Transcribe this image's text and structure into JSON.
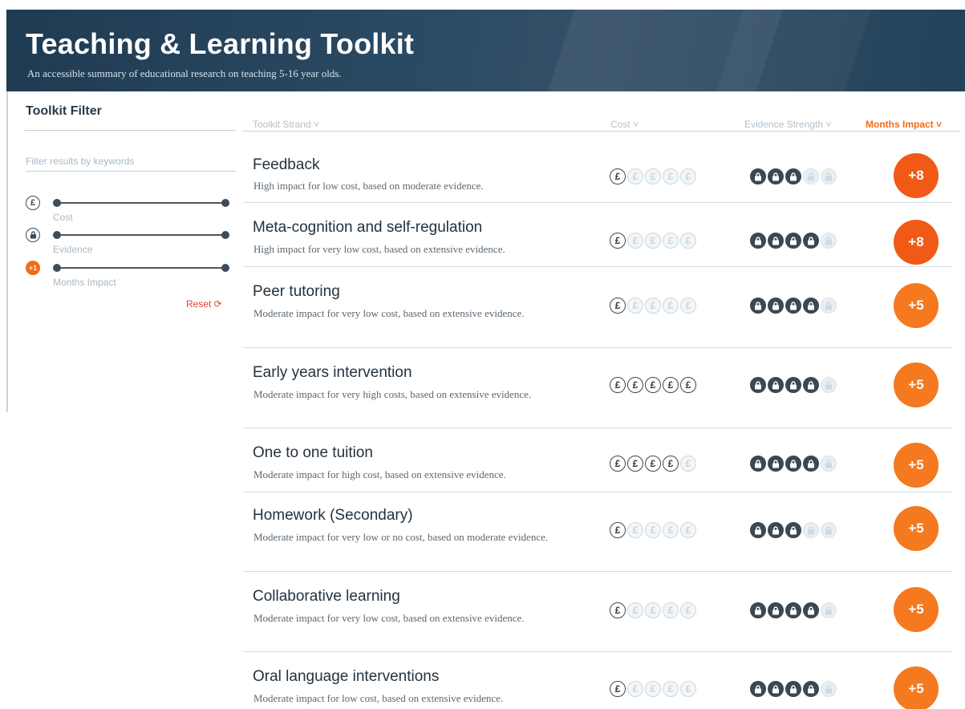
{
  "header": {
    "title": "Teaching & Learning Toolkit",
    "subtitle": "An accessible summary of educational research on teaching 5-16 year olds."
  },
  "sidebar": {
    "title": "Toolkit Filter",
    "search_placeholder": "Filter results by keywords",
    "sliders": [
      {
        "icon": "£",
        "label": "Cost"
      },
      {
        "icon": "🔒",
        "label": "Evidence"
      },
      {
        "icon": "+1",
        "label": "Months Impact"
      }
    ],
    "reset_label": "Reset ⟳"
  },
  "table": {
    "columns": {
      "strand": "Toolkit Strand ˅",
      "cost": "Cost ˅",
      "evidence": "Evidence Strength ˅",
      "impact": "Months Impact ˅"
    },
    "rows": [
      {
        "title": "Feedback",
        "desc": "High impact for low cost, based on moderate evidence.",
        "cost": 1,
        "evidence": 3,
        "impact": "+8"
      },
      {
        "title": "Meta-cognition and self-regulation",
        "desc": "High impact for very low cost, based on extensive evidence.",
        "cost": 1,
        "evidence": 4,
        "impact": "+8"
      },
      {
        "title": "Peer tutoring",
        "desc": "Moderate impact for very low cost, based on extensive evidence.",
        "cost": 1,
        "evidence": 4,
        "impact": "+5"
      },
      {
        "title": "Early years intervention",
        "desc": "Moderate impact for very high costs, based on extensive evidence.",
        "cost": 5,
        "evidence": 4,
        "impact": "+5"
      },
      {
        "title": "One to one tuition",
        "desc": "Moderate impact for high cost, based on extensive evidence.",
        "cost": 4,
        "evidence": 4,
        "impact": "+5"
      },
      {
        "title": "Homework (Secondary)",
        "desc": "Moderate impact for very low or no cost, based on moderate evidence.",
        "cost": 1,
        "evidence": 3,
        "impact": "+5"
      },
      {
        "title": "Collaborative learning",
        "desc": "Moderate impact for very low cost, based on extensive evidence.",
        "cost": 1,
        "evidence": 4,
        "impact": "+5"
      },
      {
        "title": "Oral language interventions",
        "desc": "Moderate impact for low cost, based on extensive evidence.",
        "cost": 1,
        "evidence": 4,
        "impact": "+5"
      }
    ]
  },
  "colors": {
    "header_bg": "#23425a",
    "accent_orange": "#f4791f",
    "reset_red": "#e5432f"
  }
}
